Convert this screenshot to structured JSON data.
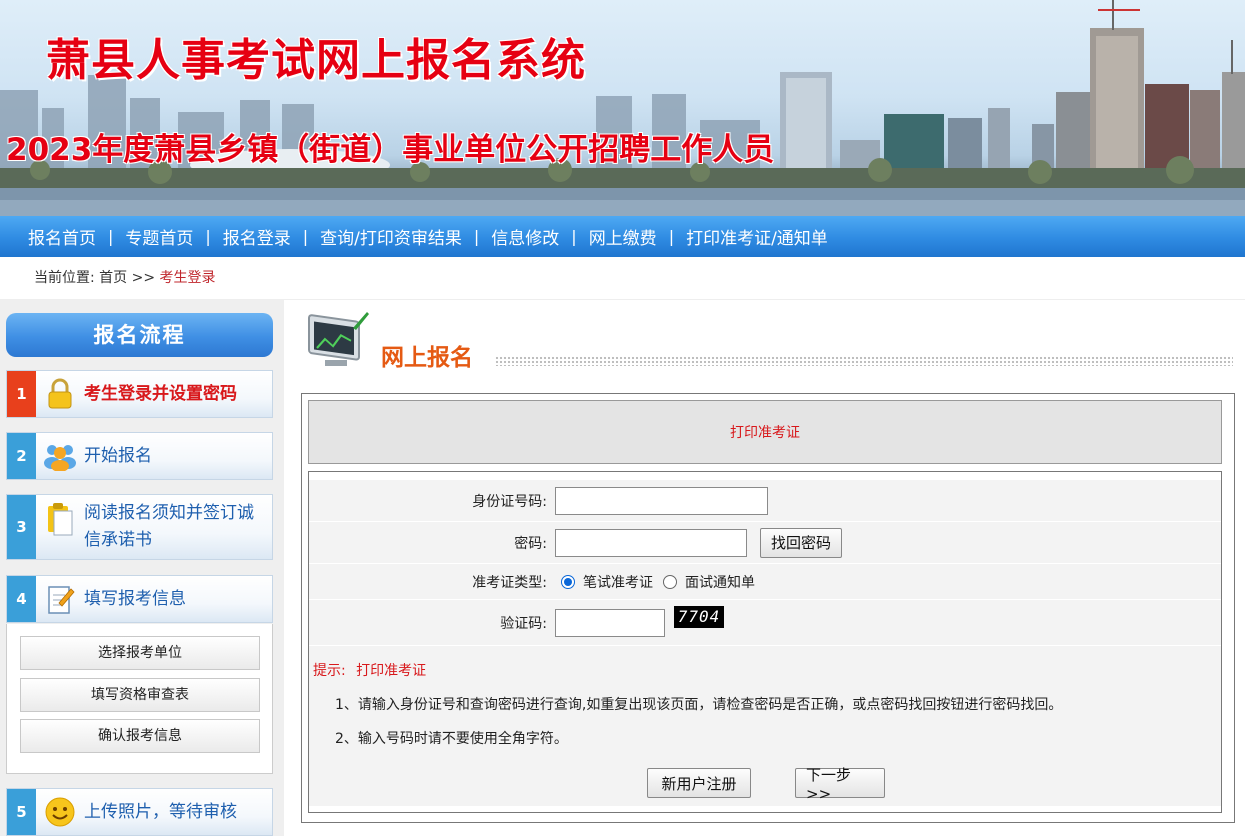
{
  "banner": {
    "title": "萧县人事考试网上报名系统",
    "subtitle": "2023年度萧县乡镇（街道）事业单位公开招聘工作人员"
  },
  "nav": {
    "items": [
      "报名首页",
      "专题首页",
      "报名登录",
      "查询/打印资审结果",
      "信息修改",
      "网上缴费",
      "打印准考证/通知单"
    ],
    "separator": "|"
  },
  "breadcrumb": {
    "prefix": "当前位置:",
    "home": "首页",
    "arrow": ">>",
    "current": "考生登录"
  },
  "flow": {
    "title": "报名流程",
    "steps": [
      {
        "num": "1",
        "label": "考生登录并设置密码",
        "icon": "lock-icon",
        "active": true
      },
      {
        "num": "2",
        "label": "开始报名",
        "icon": "users-icon"
      },
      {
        "num": "3",
        "label": "阅读报名须知并签订诚信承诺书",
        "icon": "clipboard-icon"
      },
      {
        "num": "4",
        "label": "填写报考信息",
        "icon": "notepad-pencil-icon"
      },
      {
        "num": "5",
        "label": "上传照片，等待审核",
        "icon": "smiley-icon"
      }
    ],
    "substeps": [
      "选择报考单位",
      "填写资格审查表",
      "确认报考信息"
    ]
  },
  "section": {
    "title": "网上报名",
    "form_title": "打印准考证"
  },
  "form": {
    "id_label": "身份证号码:",
    "id_value": "",
    "password_label": "密码:",
    "password_value": "",
    "find_password_button": "找回密码",
    "ticket_type_label": "准考证类型:",
    "ticket_options": [
      "笔试准考证",
      "面试通知单"
    ],
    "ticket_selected": "笔试准考证",
    "captcha_label": "验证码:",
    "captcha_value": "",
    "captcha_image_text": "7704",
    "hint_prefix": "提示:",
    "hint_title": "打印准考证",
    "notes": [
      "1、请输入身份证号和查询密码进行查询,如重复出现该页面，请检查密码是否正确，或点密码找回按钮进行密码找回。",
      "2、输入号码时请不要使用全角字符。"
    ],
    "register_button": "新用户注册",
    "next_button": "下一步>>"
  },
  "colors": {
    "title_red": "#e60012",
    "nav_blue": "#2f8be2",
    "step_active": "#e8401c",
    "step_num": "#3a9fd9",
    "section_orange": "#e55a13"
  }
}
